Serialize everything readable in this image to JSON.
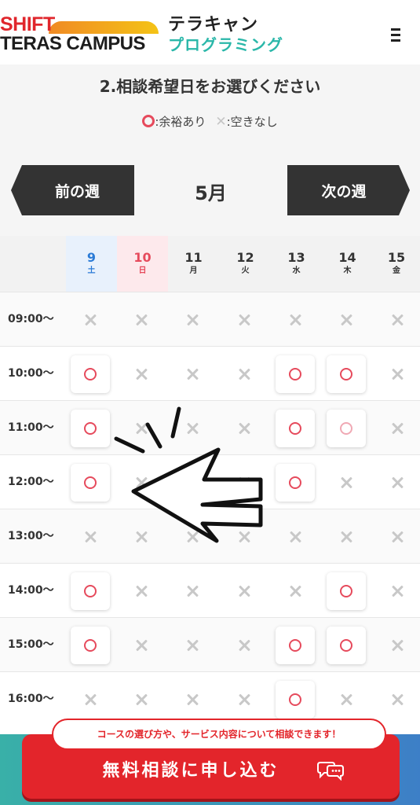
{
  "header": {
    "logo_line1": "SHIFT",
    "logo_line2": "TERAS CAMPUS",
    "logo_jp_line1": "テラキャン",
    "logo_jp_line2": "プログラミング",
    "menu_icon": "hamburger-menu-icon"
  },
  "section": {
    "title": "2.相談希望日をお選びください",
    "legend_available": ":余裕あり",
    "legend_unavailable": ":空きなし",
    "legend_unavailable_symbol": "✕"
  },
  "nav": {
    "prev_label": "前の週",
    "next_label": "次の週",
    "month": "5月"
  },
  "colors": {
    "accent_red": "#e3252b",
    "available_circle": "#e64a5c",
    "saturday": "#2b7bd6",
    "sunday": "#e64a5c",
    "header_teal": "#2ab7a9"
  },
  "days": [
    {
      "num": "9",
      "weekday": "土",
      "kind": "sat"
    },
    {
      "num": "10",
      "weekday": "日",
      "kind": "sun"
    },
    {
      "num": "11",
      "weekday": "月",
      "kind": "weekday"
    },
    {
      "num": "12",
      "weekday": "火",
      "kind": "weekday"
    },
    {
      "num": "13",
      "weekday": "水",
      "kind": "weekday"
    },
    {
      "num": "14",
      "weekday": "木",
      "kind": "weekday"
    },
    {
      "num": "15",
      "weekday": "金",
      "kind": "weekday"
    }
  ],
  "slots": [
    {
      "time": "09:00〜",
      "cells": [
        "x",
        "x",
        "x",
        "x",
        "x",
        "x",
        "x"
      ]
    },
    {
      "time": "10:00〜",
      "cells": [
        "o",
        "x",
        "x",
        "x",
        "o",
        "o",
        "x"
      ]
    },
    {
      "time": "11:00〜",
      "cells": [
        "o",
        "x",
        "x",
        "x",
        "o",
        "o-faint",
        "x"
      ]
    },
    {
      "time": "12:00〜",
      "cells": [
        "o",
        "x",
        "x",
        "x",
        "o",
        "x",
        "x"
      ]
    },
    {
      "time": "13:00〜",
      "cells": [
        "x",
        "x",
        "x",
        "x",
        "x",
        "x",
        "x"
      ]
    },
    {
      "time": "14:00〜",
      "cells": [
        "o",
        "x",
        "x",
        "x",
        "x",
        "o",
        "x"
      ]
    },
    {
      "time": "15:00〜",
      "cells": [
        "o",
        "x",
        "x",
        "x",
        "o",
        "o",
        "x"
      ]
    },
    {
      "time": "16:00〜",
      "cells": [
        "x",
        "x",
        "x",
        "x",
        "o",
        "x",
        "x"
      ]
    }
  ],
  "cta": {
    "bubble_text": "コースの選び方や、サービス内容について相談できます！",
    "button_label": "無料相談に申し込む",
    "icon": "chat-bubbles-icon"
  }
}
